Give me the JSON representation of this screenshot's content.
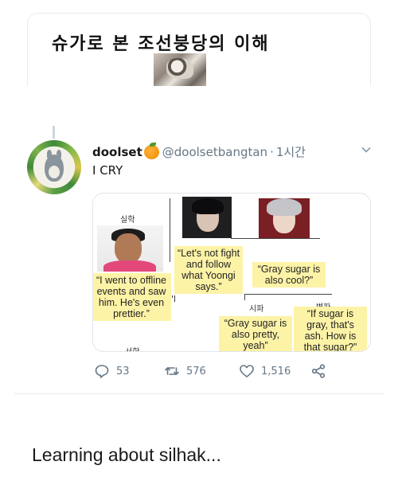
{
  "quoted": {
    "title": "슈가로 본 조선붕당의 이해"
  },
  "tweet": {
    "display_name": "doolset",
    "handle": "@doolsetbangtan",
    "separator": "·",
    "time": "1시간",
    "text": "I CRY"
  },
  "media": {
    "labels": {
      "silhak": "실학",
      "sipa": "시파",
      "byeokpa": "벽파",
      "seohak": "서학",
      "mark": "'l"
    },
    "captions": [
      "“I went to offline events and saw him. He's even prettier.”",
      "“Let's not fight and follow what Yoongi says.”",
      "“Gray sugar is also cool?”",
      "“Gray sugar is also pretty, yeah”",
      "“If sugar is gray, that's ash. How is that sugar?”"
    ]
  },
  "actions": {
    "reply_count": "53",
    "retweet_count": "576",
    "like_count": "1,516"
  },
  "icons": {
    "reply": "reply-icon",
    "retweet": "retweet-icon",
    "like": "heart-icon",
    "share": "share-icon",
    "caret": "chevron-down-icon"
  },
  "footer": {
    "caption": "Learning about silhak..."
  }
}
